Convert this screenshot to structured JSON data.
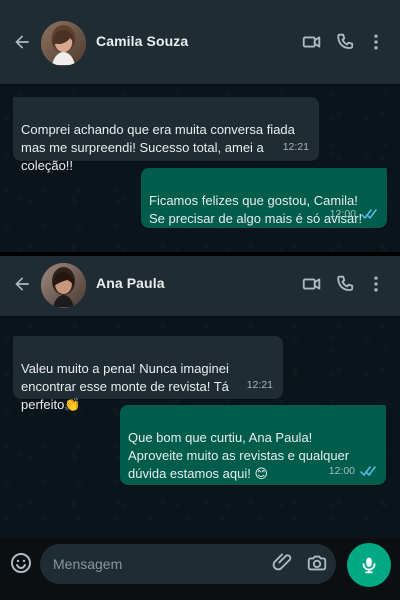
{
  "colors": {
    "header_bg": "#202c33",
    "chat_bg": "#0b141a",
    "incoming_bubble": "#202c33",
    "outgoing_bubble": "#005c4b",
    "accent": "#00a884",
    "read_ticks": "#53bdeb"
  },
  "chats": [
    {
      "contact_name": "Camila Souza",
      "messages": [
        {
          "direction": "incoming",
          "text": "Comprei achando que era muita conversa fiada\nmas me surpreendi! Sucesso total, amei a coleção!!",
          "time": "12:21"
        },
        {
          "direction": "outgoing",
          "text": "Ficamos felizes que gostou, Camila!\nSe precisar de algo mais é só avisar!",
          "time": "12:00",
          "status": "read"
        }
      ]
    },
    {
      "contact_name": "Ana Paula",
      "messages": [
        {
          "direction": "incoming",
          "text": "Valeu muito a pena! Nunca imaginei\nencontrar esse monte de revista! Tá perfeito👏",
          "time": "12:21"
        },
        {
          "direction": "outgoing",
          "text": "Que bom que curtiu, Ana Paula!\nAproveite muito as revistas e qualquer\ndúvida estamos aqui! 😊",
          "time": "12:00",
          "status": "read"
        }
      ]
    }
  ],
  "composer": {
    "placeholder": "Mensagem"
  },
  "icons": {
    "back": "arrow-left-icon",
    "video": "video-camera-icon",
    "call": "phone-icon",
    "menu": "vertical-dots-icon",
    "emoji": "smile-icon",
    "attach": "paperclip-icon",
    "camera": "camera-icon",
    "mic": "microphone-icon"
  }
}
